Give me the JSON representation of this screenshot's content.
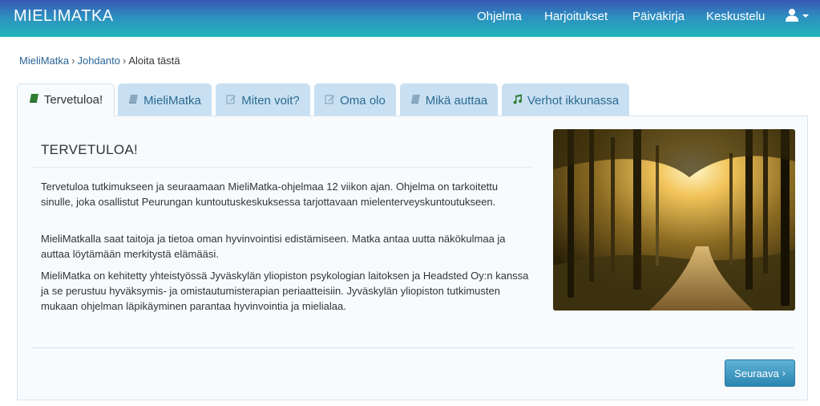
{
  "navbar": {
    "brand": "MIELIMATKA",
    "items": [
      {
        "label": "Ohjelma"
      },
      {
        "label": "Harjoitukset"
      },
      {
        "label": "Päiväkirja"
      },
      {
        "label": "Keskustelu"
      }
    ],
    "user_icon": "user-icon"
  },
  "breadcrumb": {
    "items": [
      "MieliMatka",
      "Johdanto",
      "Aloita tästä"
    ],
    "separator": "›"
  },
  "tabs": [
    {
      "label": "Tervetuloa!",
      "icon": "book-icon",
      "active": true
    },
    {
      "label": "MieliMatka",
      "icon": "book-icon"
    },
    {
      "label": "Miten voit?",
      "icon": "edit-icon"
    },
    {
      "label": "Oma olo",
      "icon": "edit-icon"
    },
    {
      "label": "Mikä auttaa",
      "icon": "book-icon"
    },
    {
      "label": "Verhot ikkunassa",
      "icon": "music-icon"
    }
  ],
  "content": {
    "title": "TERVETULOA!",
    "paragraphs": [
      "Tervetuloa tutkimukseen ja seuraamaan MieliMatka-ohjelmaa 12 viikon ajan. Ohjelma on tarkoitettu sinulle, joka osallistut Peurungan kuntoutuskeskuksessa tarjottavaan mielenterveyskuntoutukseen.",
      "MieliMatkalla saat taitoja ja tietoa oman hyvinvointisi edistämiseen. Matka antaa uutta näkökulmaa ja auttaa löytämään merkitystä elämääsi.",
      "MieliMatka on kehitetty yhteistyössä Jyväskylän yliopiston psykologian laitoksen ja Headsted Oy:n kanssa ja se perustuu hyväksymis- ja omistautumisterapian periaatteisiin. Jyväskylän yliopiston tutkimusten mukaan ohjelman läpikäyminen parantaa hyvinvointia ja mielialaa."
    ],
    "next_button": "Seuraava",
    "next_icon": "chevron-right-icon"
  },
  "colors": {
    "nav_gradient_top": "#3a55b4",
    "nav_gradient_bottom": "#23b3b9",
    "tab_inactive": "#c8e0f2",
    "link": "#2a6496",
    "button": "#2b86b0"
  }
}
